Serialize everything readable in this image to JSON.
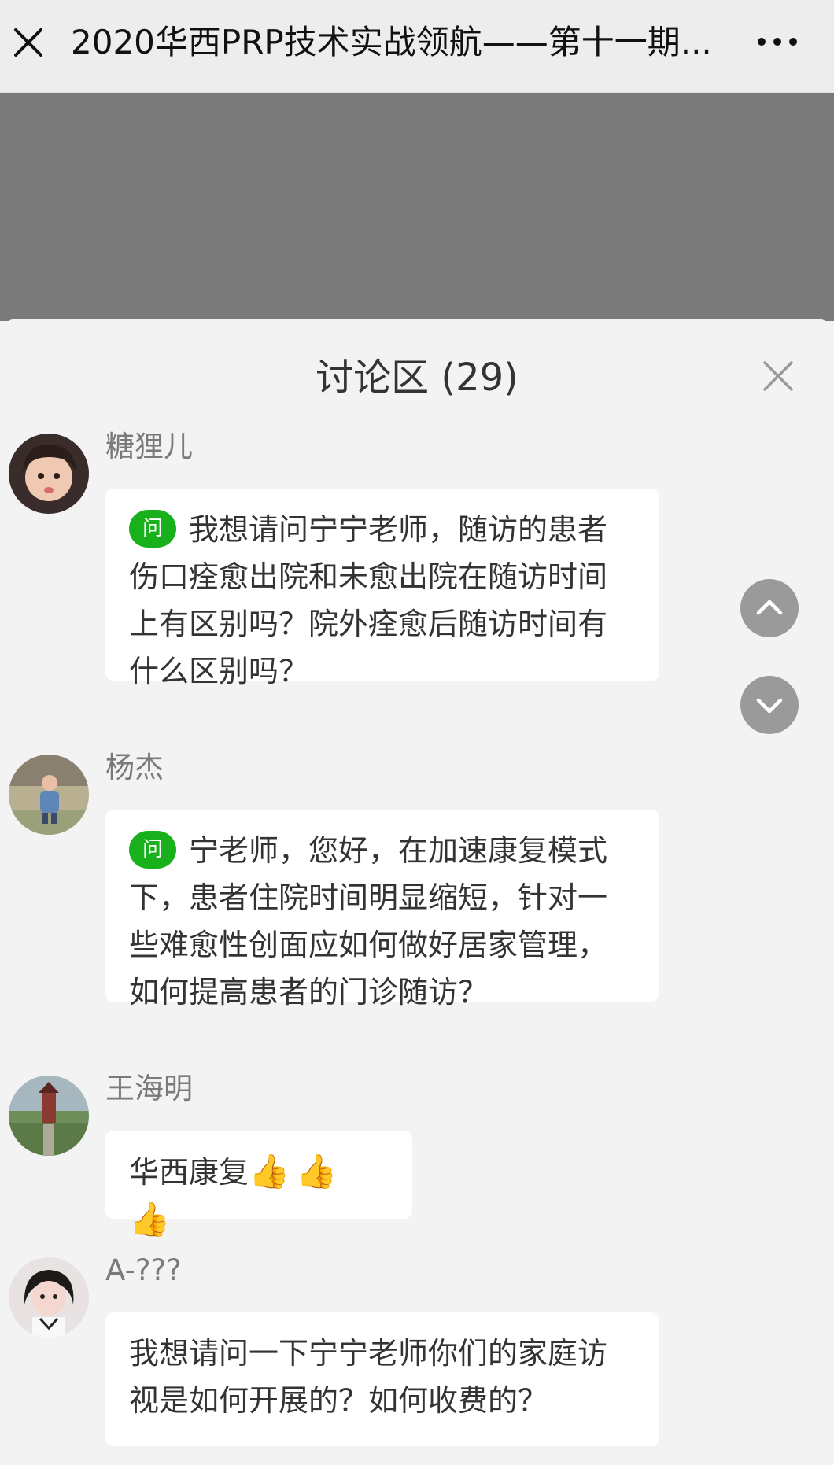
{
  "header": {
    "title": "2020华西PRP技术实战领航——第十一期..."
  },
  "panel": {
    "title": "讨论区 (29)"
  },
  "comments": [
    {
      "user": "糖狸儿",
      "badge": "问",
      "text": "我想请问宁宁老师，随访的患者伤口痊愈出院和未愈出院在随访时间上有区别吗？院外痊愈后随访时间有什么区别吗？"
    },
    {
      "user": "杨杰",
      "badge": "问",
      "text": "宁老师，您好，在加速康复模式下，患者住院时间明显缩短，针对一些难愈性创面应如何做好居家管理，如何提高患者的门诊随访？"
    },
    {
      "user": "王海明",
      "text": "华西康复",
      "emoji": "👍👍👍"
    },
    {
      "user": "A-???",
      "text": "我想请问一下宁宁老师你们的家庭访视是如何开展的？如何收费的？"
    }
  ],
  "colors": {
    "topbar": "#ededed",
    "video": "#7a7a7a",
    "panel": "#f3f3f3",
    "badge": "#19b11b",
    "scroll_button": "#9a9a9a"
  },
  "icons": {
    "close": "close-icon",
    "more": "more-dots-icon",
    "panel_close": "close-icon",
    "scroll_up": "chevron-up-icon",
    "scroll_down": "chevron-down-icon"
  }
}
